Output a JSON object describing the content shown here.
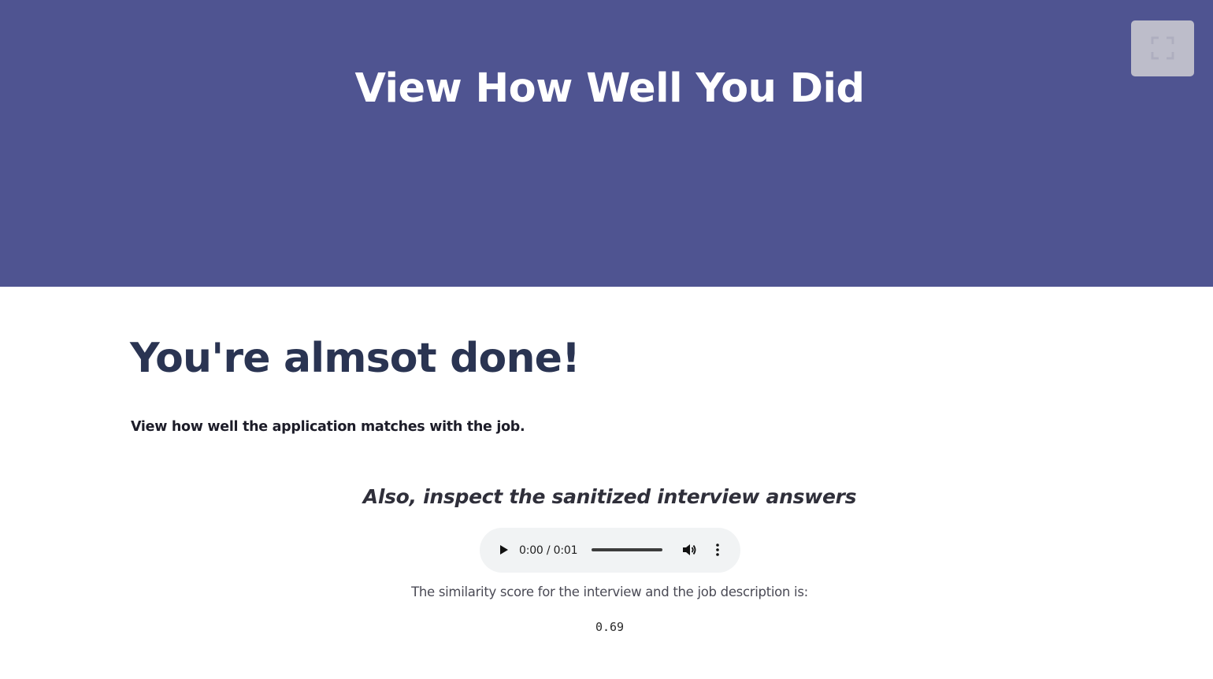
{
  "header": {
    "title": "View How Well You Did",
    "background_color": "#4f5491",
    "fullscreen_button": {
      "icon": "fullscreen-icon"
    }
  },
  "main": {
    "title": "You're almsot done!",
    "subtitle": "View how well the application matches with the job.",
    "section_heading": "Also, inspect the sanitized interview answers",
    "audio_player": {
      "time": "0:00 / 0:01",
      "play_icon": "play-icon",
      "volume_icon": "volume-icon",
      "more_icon": "more-options-icon"
    },
    "score_label": "The similarity score for the interview and the job description is:",
    "score_value": "0.69"
  }
}
